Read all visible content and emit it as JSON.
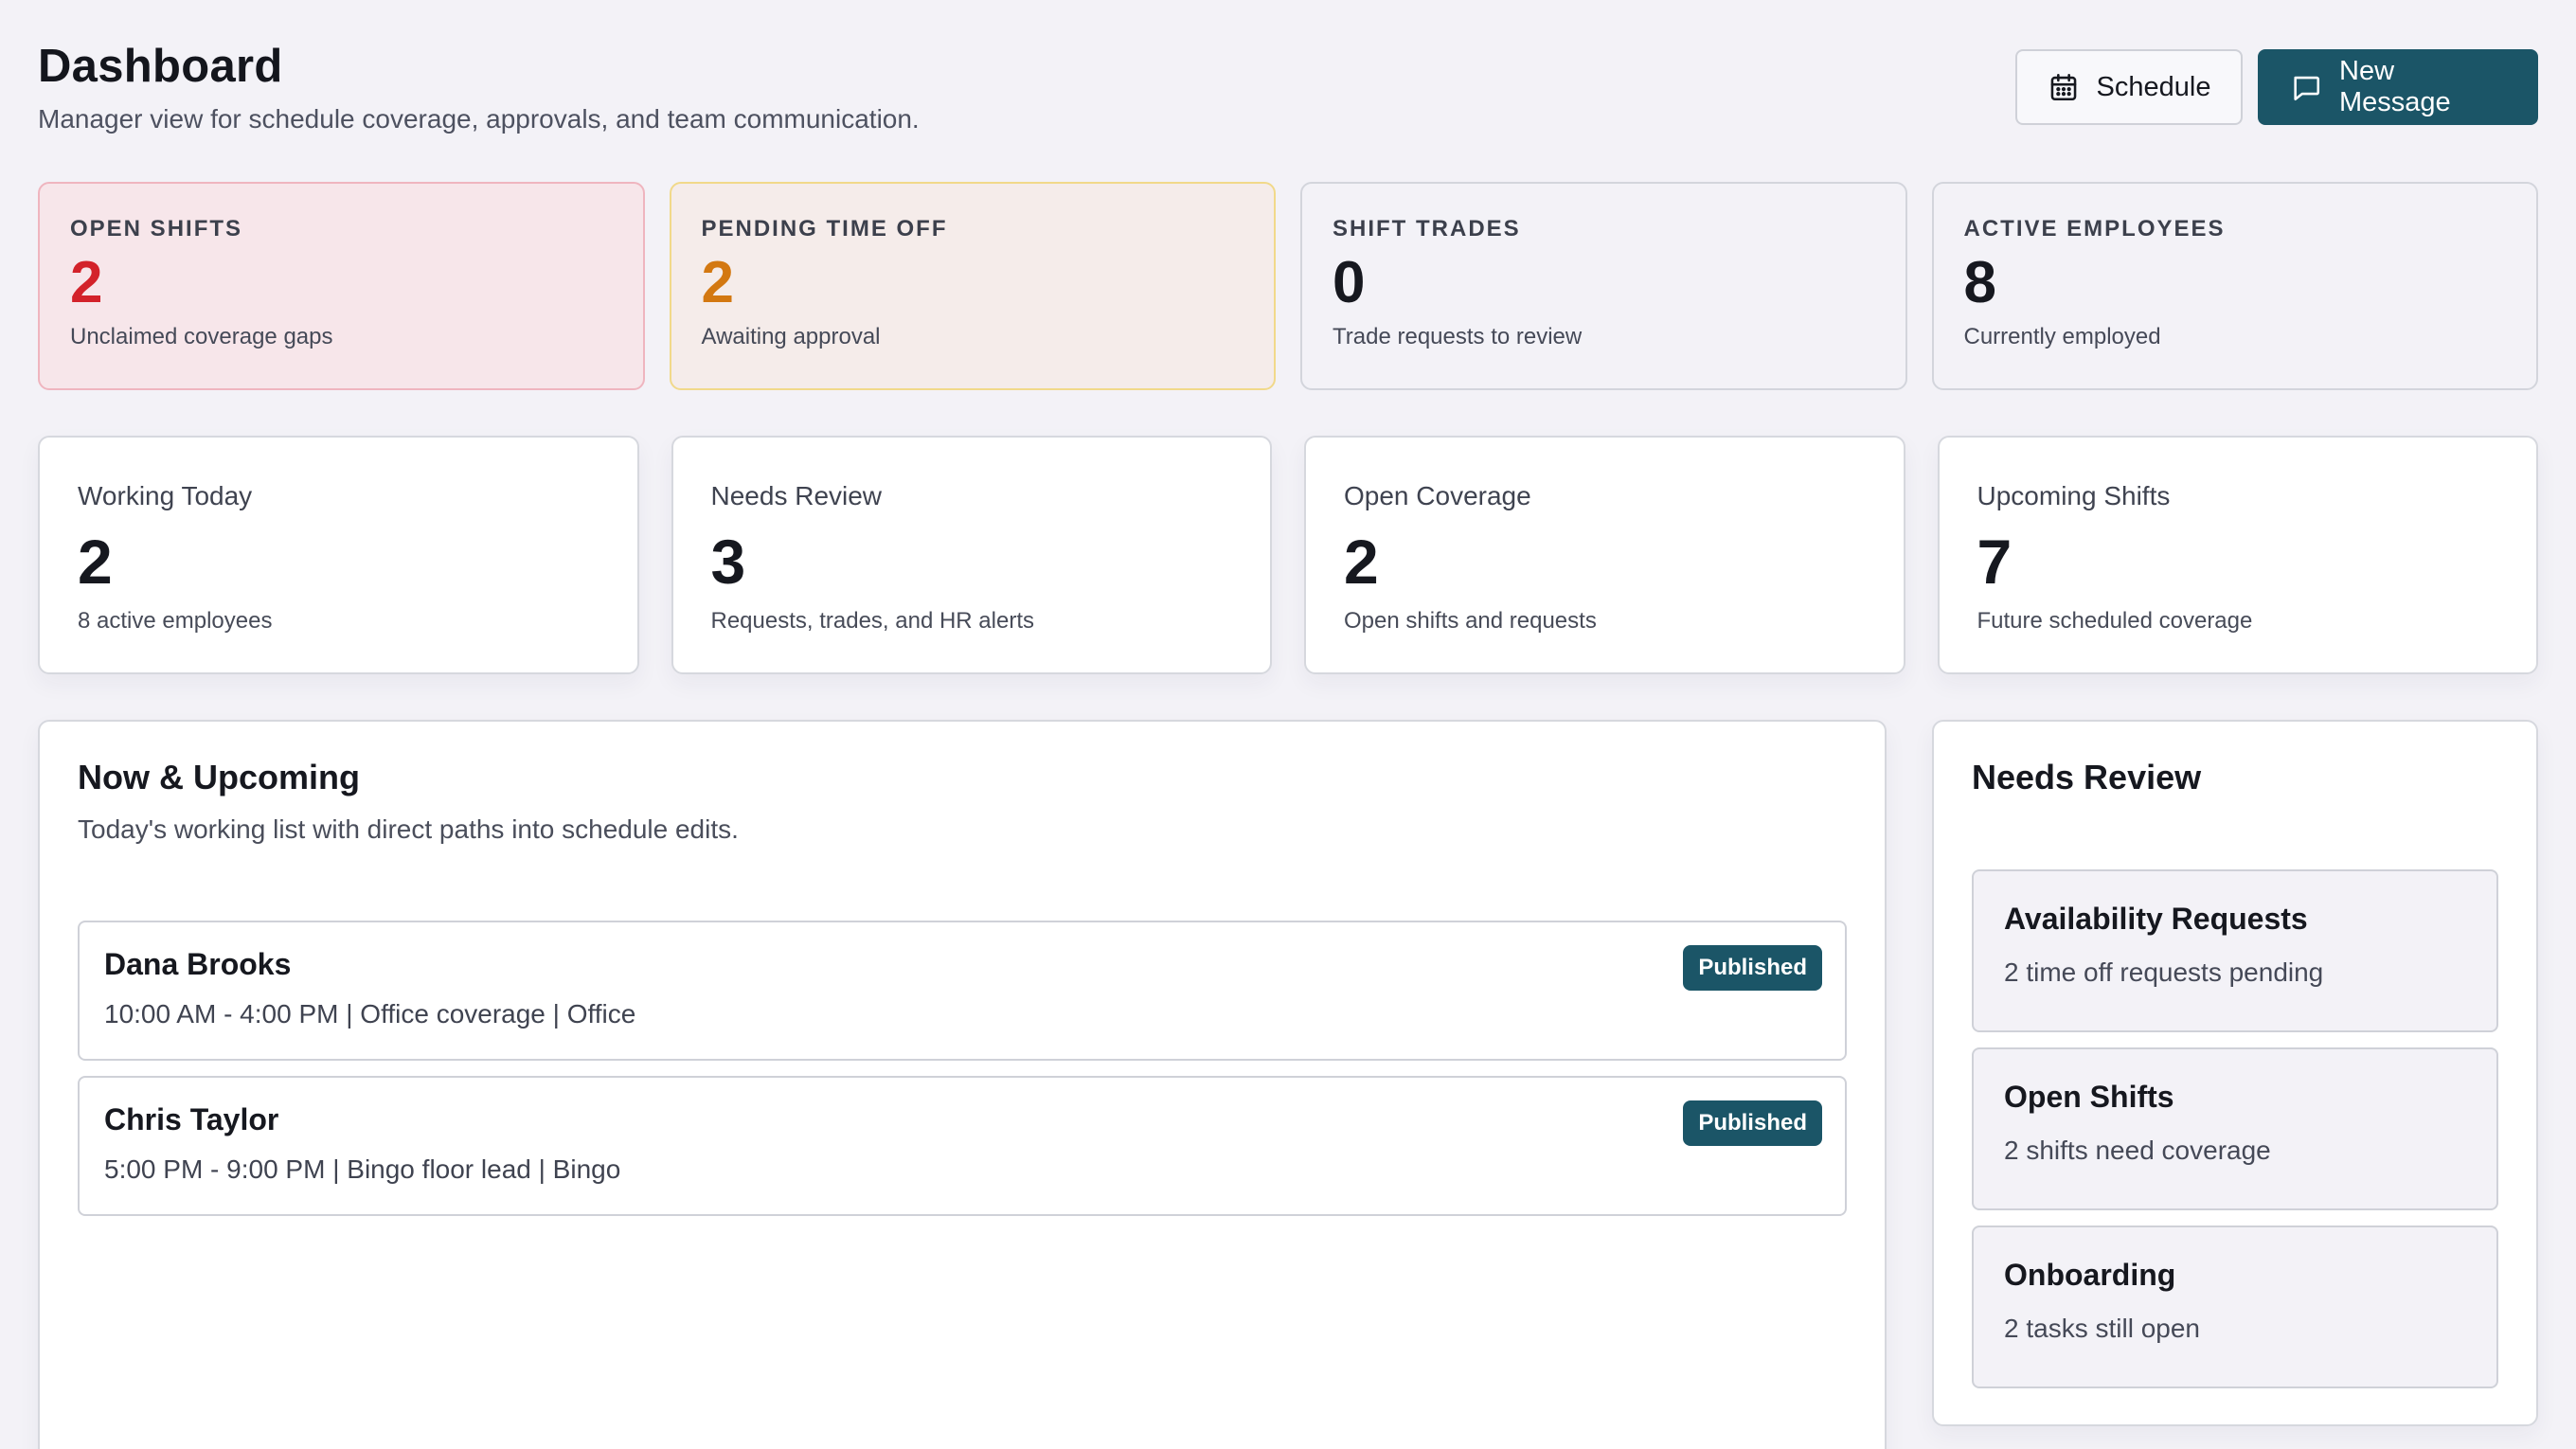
{
  "header": {
    "title": "Dashboard",
    "subtitle": "Manager view for schedule coverage, approvals, and team communication.",
    "schedule_label": "Schedule",
    "new_message_label": "New Message"
  },
  "stats": [
    {
      "label": "Open Shifts",
      "value": "2",
      "note": "Unclaimed coverage gaps",
      "tone": "red"
    },
    {
      "label": "Pending Time Off",
      "value": "2",
      "note": "Awaiting approval",
      "tone": "amber"
    },
    {
      "label": "Shift Trades",
      "value": "0",
      "note": "Trade requests to review",
      "tone": "neutral"
    },
    {
      "label": "Active Employees",
      "value": "8",
      "note": "Currently employed",
      "tone": "neutral"
    }
  ],
  "metrics": [
    {
      "label": "Working Today",
      "value": "2",
      "note": "8 active employees"
    },
    {
      "label": "Needs Review",
      "value": "3",
      "note": "Requests, trades, and HR alerts"
    },
    {
      "label": "Open Coverage",
      "value": "2",
      "note": "Open shifts and requests"
    },
    {
      "label": "Upcoming Shifts",
      "value": "7",
      "note": "Future scheduled coverage"
    }
  ],
  "upcoming": {
    "title": "Now & Upcoming",
    "subtitle": "Today's working list with direct paths into schedule edits.",
    "shifts": [
      {
        "name": "Dana Brooks",
        "detail": "10:00 AM - 4:00 PM | Office coverage | Office",
        "status": "Published"
      },
      {
        "name": "Chris Taylor",
        "detail": "5:00 PM - 9:00 PM | Bingo floor lead | Bingo",
        "status": "Published"
      }
    ]
  },
  "review": {
    "title": "Needs Review",
    "items": [
      {
        "title": "Availability Requests",
        "note": "2 time off requests pending"
      },
      {
        "title": "Open Shifts",
        "note": "2 shifts need coverage"
      },
      {
        "title": "Onboarding",
        "note": "2 tasks still open"
      }
    ]
  },
  "colors": {
    "primary": "#1b5567",
    "danger": "#d3222a",
    "warning": "#d37811",
    "background": "#f3f2f7"
  },
  "icons": {
    "schedule_button": "calendar-icon",
    "new_message_button": "message-icon"
  }
}
